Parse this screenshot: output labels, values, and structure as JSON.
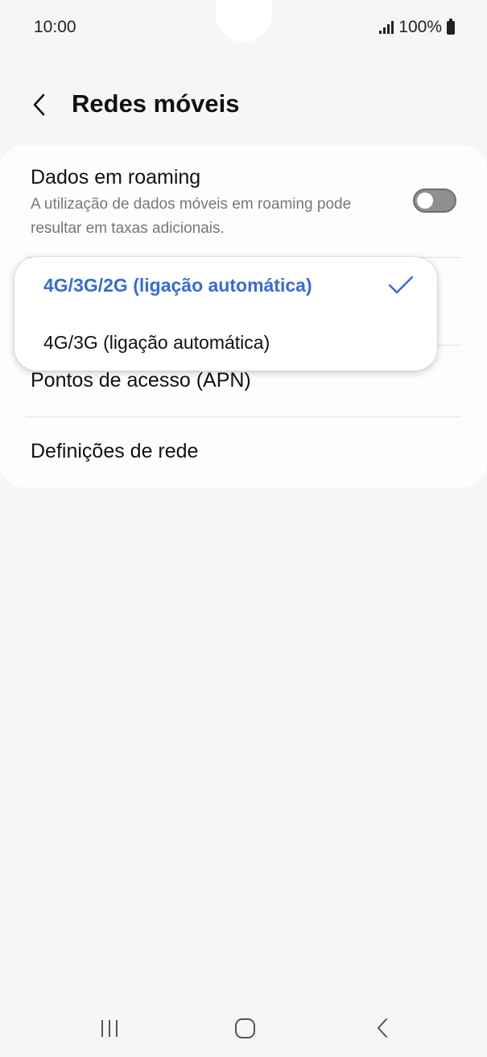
{
  "status_bar": {
    "time": "10:00",
    "battery": "100%"
  },
  "header": {
    "title": "Redes móveis"
  },
  "settings": {
    "roaming": {
      "title": "Dados em roaming",
      "subtitle_line1": "A utilização de dados móveis em roaming pode",
      "subtitle_line2": "resultar em taxas adicionais.",
      "enabled": false
    },
    "apn": {
      "title": "Pontos de acesso (APN)"
    },
    "network_settings": {
      "title": "Definições de rede"
    }
  },
  "network_mode_popup": {
    "options": [
      {
        "label": "4G/3G/2G (ligação automática)",
        "selected": true
      },
      {
        "label": "4G/3G (ligação automática)",
        "selected": false
      }
    ]
  },
  "colors": {
    "accent": "#3a6bd0",
    "background": "#f6f6f8",
    "card": "#fdfdfd"
  },
  "icons": {
    "back": "chevron-left-icon",
    "check": "check-icon",
    "nav_recents": "recents-icon",
    "nav_home": "home-icon",
    "nav_back": "back-icon"
  }
}
